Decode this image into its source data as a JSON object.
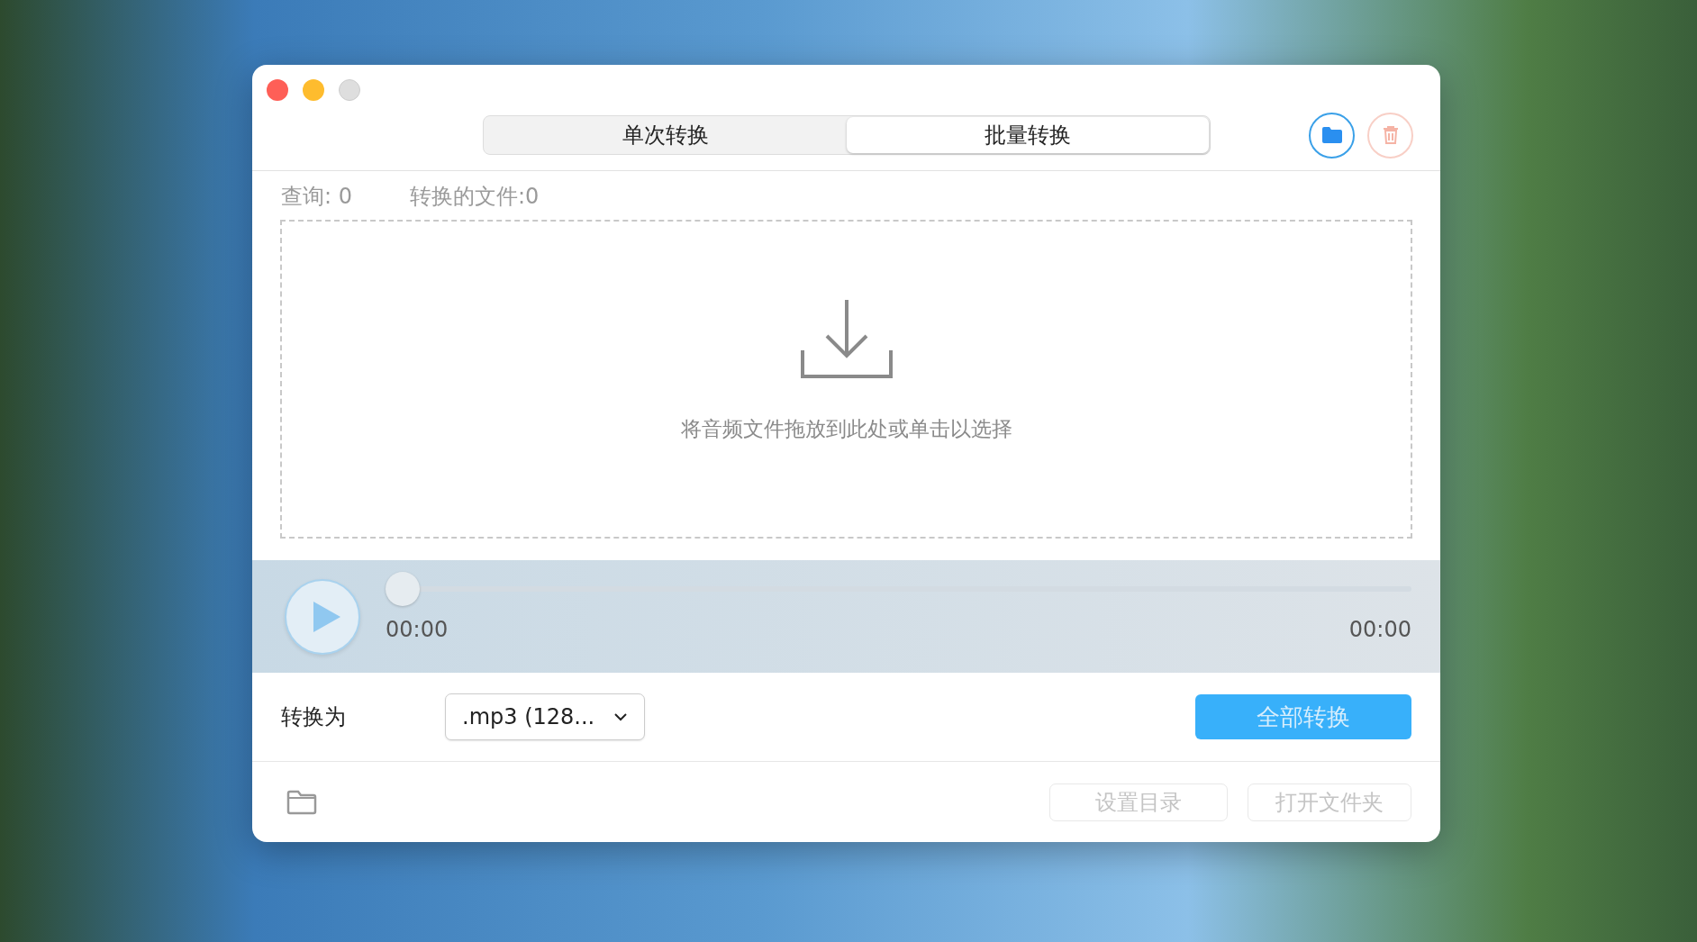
{
  "tabs": [
    {
      "label": "单次转换",
      "selected": false
    },
    {
      "label": "批量转换",
      "selected": true
    }
  ],
  "toolbar": {
    "delete_disabled": true
  },
  "stats": [
    "查询: 0",
    "转换的文件:0"
  ],
  "dropzone": {
    "hint": "将音频文件拖放到此处或单击以选择"
  },
  "player": {
    "level": 0,
    "elapsed": "00:00",
    "total": "00:00"
  },
  "convert": {
    "label": "转换为",
    "format": ".mp3 (128...",
    "button": "全部转换"
  },
  "footer": {
    "buttons": [
      {
        "label": "设置目录",
        "disabled": true
      },
      {
        "label": "打开文件夹",
        "disabled": true
      }
    ]
  }
}
